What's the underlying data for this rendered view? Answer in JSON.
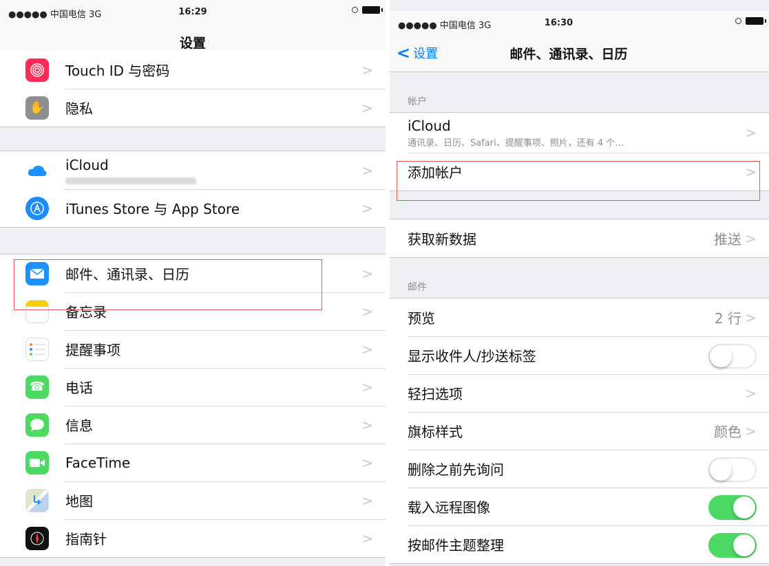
{
  "left": {
    "status": {
      "carrier": "●●●●● 中国电信  3G",
      "time": "16:29"
    },
    "nav_title": "设置",
    "rows": [
      {
        "label": "Touch ID 与密码",
        "icon": "fingerprint-icon",
        "color": "#ff2d55"
      },
      {
        "label": "隐私",
        "icon": "hand-icon",
        "color": "#8e8e93"
      },
      {
        "label": "iCloud",
        "icon": "cloud-icon",
        "color": "#ffffff"
      },
      {
        "label": "iTunes Store 与 App Store",
        "icon": "app-store-icon",
        "color": "#1a8cff"
      },
      {
        "label": "邮件、通讯录、日历",
        "icon": "mail-icon",
        "color": "#1e90ff"
      },
      {
        "label": "备忘录",
        "icon": "notes-icon",
        "color": "#ffffff"
      },
      {
        "label": "提醒事项",
        "icon": "reminders-icon",
        "color": "#ffffff"
      },
      {
        "label": "电话",
        "icon": "phone-icon",
        "color": "#4cd964"
      },
      {
        "label": "信息",
        "icon": "messages-icon",
        "color": "#4cd964"
      },
      {
        "label": "FaceTime",
        "icon": "facetime-icon",
        "color": "#4cd964"
      },
      {
        "label": "地图",
        "icon": "maps-icon",
        "color": "#ffffff"
      },
      {
        "label": "指南针",
        "icon": "compass-icon",
        "color": "#111111"
      }
    ]
  },
  "right": {
    "status": {
      "carrier": "●●●●● 中国电信  3G",
      "time": "16:30"
    },
    "back_label": "设置",
    "nav_title": "邮件、通讯录、日历",
    "section_accounts": "帐户",
    "icloud_title": "iCloud",
    "icloud_sub": "通讯录、日历、Safari、提醒事项、照片，还有 4 个…",
    "add_account": "添加帐户",
    "fetch_new_data": "获取新数据",
    "fetch_value": "推送",
    "section_mail": "邮件",
    "preview": "预览",
    "preview_value": "2 行",
    "show_to_cc": "显示收件人/抄送标签",
    "show_to_cc_on": false,
    "swipe_options": "轻扫选项",
    "flag_style": "旗标样式",
    "flag_value": "颜色",
    "ask_before_delete": "删除之前先询问",
    "ask_before_delete_on": false,
    "load_remote_images": "载入远程图像",
    "load_remote_images_on": true,
    "organize_by_thread": "按邮件主题整理",
    "organize_by_thread_on": true
  },
  "colors": {
    "accent": "#0a7cf2",
    "toggle_on": "#4cd964",
    "highlight": "#e05a5a"
  }
}
